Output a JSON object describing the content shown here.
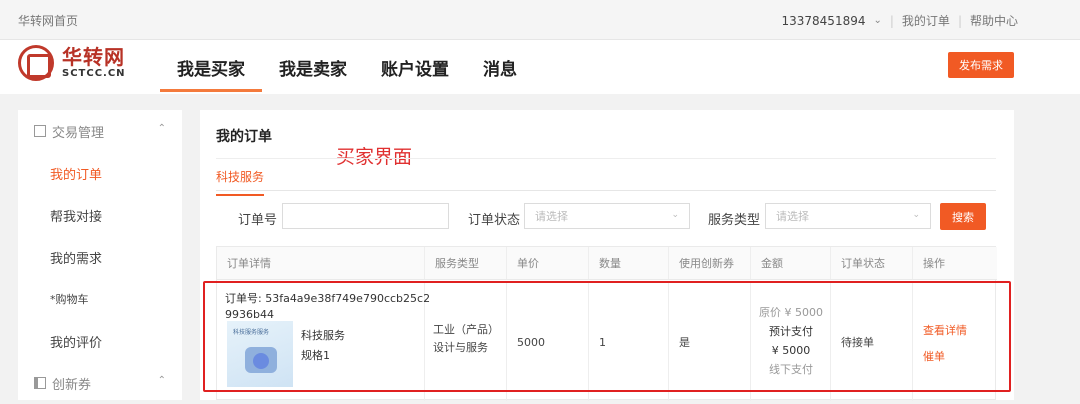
{
  "topbar": {
    "home_link": "华转网首页",
    "phone": "13378451894",
    "my_orders": "我的订单",
    "help_center": "帮助中心",
    "separator": "|"
  },
  "header": {
    "logo_cn": "华转网",
    "logo_en": "SCTCC.CN",
    "nav": [
      "我是买家",
      "我是卖家",
      "账户设置",
      "消息"
    ],
    "active_nav": "我是买家",
    "publish_button": "发布需求"
  },
  "sidebar": {
    "group1": "交易管理",
    "items": [
      "我的订单",
      "帮我对接",
      "我的需求",
      "*购物车",
      "我的评价"
    ],
    "active_item": "我的订单",
    "group2": "创新券"
  },
  "main": {
    "title": "我的订单",
    "annotation": "买家界面",
    "subtab": "科技服务",
    "filters": {
      "order_no_label": "订单号",
      "order_status_label": "订单状态",
      "order_status_placeholder": "请选择",
      "service_type_label": "服务类型",
      "service_type_placeholder": "请选择",
      "search_button": "搜索"
    },
    "table": {
      "headers": [
        "订单详情",
        "服务类型",
        "单价",
        "数量",
        "使用创新券",
        "金额",
        "订单状态",
        "操作"
      ],
      "row": {
        "order_no": "订单号: 53fa4a9e38f749e790ccb25c29936b44",
        "thumb_caption": "科技服务服务",
        "product_name": "科技服务",
        "product_spec": "规格1",
        "service_type_line1": "工业（产品）",
        "service_type_line2": "设计与服务",
        "unit_price": "5000",
        "quantity": "1",
        "use_voucher": "是",
        "amount_original": "原价 ¥ 5000",
        "amount_prepay_label": "预计支付",
        "amount_prepay_value": "¥ 5000",
        "amount_offline": "线下支付",
        "status": "待接单",
        "op_view": "查看详情",
        "op_urge": "催单"
      }
    }
  },
  "colors": {
    "accent": "#f15a24",
    "annotation_red": "#e03030",
    "logo_red": "#b83226"
  }
}
